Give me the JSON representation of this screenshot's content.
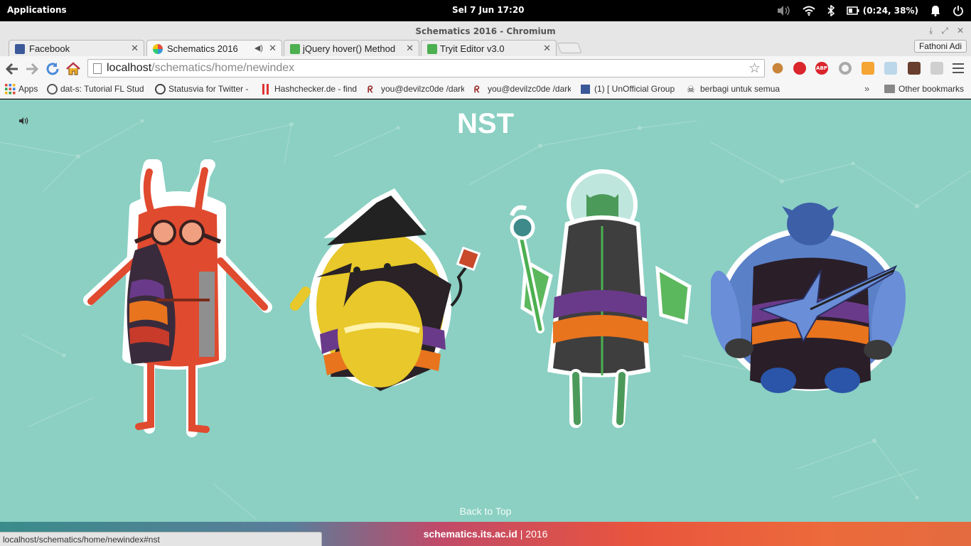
{
  "desktop": {
    "applications_label": "Applications",
    "clock": "Sel  7 Jun    17:20",
    "battery_text": "(0:24, 38%)"
  },
  "window": {
    "title": "Schematics 2016 - Chromium",
    "profile_name": "Fathoni Adi"
  },
  "tabs": [
    {
      "label": "Facebook",
      "icon": "facebook-icon",
      "color": "#3b5998"
    },
    {
      "label": "Schematics 2016",
      "icon": "schematics-icon",
      "color": "#d9534f",
      "active": true,
      "audio": true
    },
    {
      "label": "jQuery hover() Method",
      "icon": "w3schools-icon",
      "color": "#4caf50"
    },
    {
      "label": "Tryit Editor v3.0",
      "icon": "w3schools-icon",
      "color": "#4caf50"
    }
  ],
  "omnibox": {
    "url_host": "localhost",
    "url_path": "/schematics/home/newindex"
  },
  "bookmarks": [
    {
      "label": "Apps",
      "icon": "apps-grid-icon"
    },
    {
      "label": "dat-s: Tutorial FL Stud",
      "icon": "dat-s-icon"
    },
    {
      "label": "Statusvia for Twitter -",
      "icon": "statusvia-icon"
    },
    {
      "label": "Hashchecker.de - find",
      "icon": "hashchecker-icon"
    },
    {
      "label": "you@devilzc0de /dark",
      "icon": "devilzc0de-icon"
    },
    {
      "label": "you@devilzc0de /dark",
      "icon": "devilzc0de-icon"
    },
    {
      "label": "(1) [ UnOfficial Group",
      "icon": "facebook-icon"
    },
    {
      "label": "berbagi untuk semua",
      "icon": "skull-icon"
    }
  ],
  "other_bookmarks_label": "Other bookmarks",
  "page": {
    "title": "NST",
    "back_to_top": "Back to Top",
    "footer_site": "schematics.its.ac.id",
    "footer_sep": " | ",
    "footer_year": "2016"
  },
  "status_url": "localhost/schematics/home/newindex#nst"
}
